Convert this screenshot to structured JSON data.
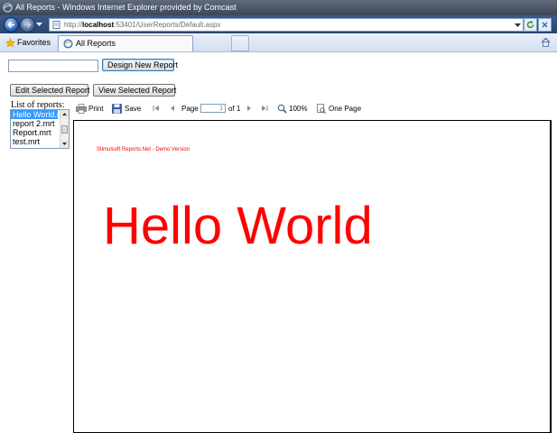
{
  "window": {
    "title": "All Reports - Windows Internet Explorer provided by Comcast"
  },
  "address": {
    "prefix": "http://",
    "host": "localhost",
    "path": ":53401/UserReports/Default.aspx"
  },
  "favorites": {
    "label": "Favorites"
  },
  "tabs": [
    {
      "label": "All Reports"
    }
  ],
  "form": {
    "report_name_value": "",
    "design_button": "Design New Report",
    "edit_button": "Edit Selected Report",
    "view_button": "View Selected Report",
    "list_label": "List of reports:",
    "reports": [
      {
        "name": "Hello World.m",
        "selected": true
      },
      {
        "name": "report 2.mrt",
        "selected": false
      },
      {
        "name": "Report.mrt",
        "selected": false
      },
      {
        "name": "test.mrt",
        "selected": false
      }
    ]
  },
  "toolbar": {
    "print": "Print",
    "save": "Save",
    "page_label": "Page",
    "page_value": "1",
    "of_label": "of 1",
    "zoom": "100%",
    "view_mode": "One Page"
  },
  "report": {
    "demo_text": "Stimulsoft Reports.Net - Demo Version",
    "heading": "Hello World"
  },
  "colors": {
    "report_text": "#ff0000",
    "selection": "#3399ff"
  }
}
